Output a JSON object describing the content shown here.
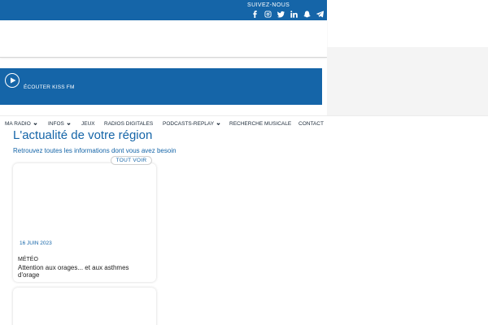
{
  "topbar": {
    "follow_label": "SUIVEZ-NOUS",
    "social_icons": [
      "facebook-icon",
      "instagram-icon",
      "twitter-icon",
      "linkedin-icon",
      "snapchat-icon",
      "telegram-icon"
    ],
    "background": "#1565a8"
  },
  "player": {
    "label": "ÉCOUTER KISS FM",
    "background": "#1565a8"
  },
  "nav": {
    "items": [
      {
        "label": "MA RADIO",
        "dropdown": true
      },
      {
        "label": "INFOS",
        "dropdown": true
      },
      {
        "label": "JEUX",
        "dropdown": false
      },
      {
        "label": "RADIOS DIGITALES",
        "dropdown": false
      },
      {
        "label": "PODCASTS-REPLAY",
        "dropdown": true
      },
      {
        "label": "RECHERCHE MUSICALE",
        "dropdown": false
      },
      {
        "label": "CONTACT",
        "dropdown": false
      }
    ]
  },
  "section": {
    "title": "L'actualité de votre région",
    "subtitle": "Retrouvez toutes les informations dont vous avez besoin",
    "see_all": "TOUT VOIR"
  },
  "cards": [
    {
      "date": "16 JUIN 2023",
      "category": "MÉTÉO",
      "title": "Attention aux orages... et aux asthmes d'orage"
    }
  ],
  "colors": {
    "accent": "#1565a8"
  }
}
